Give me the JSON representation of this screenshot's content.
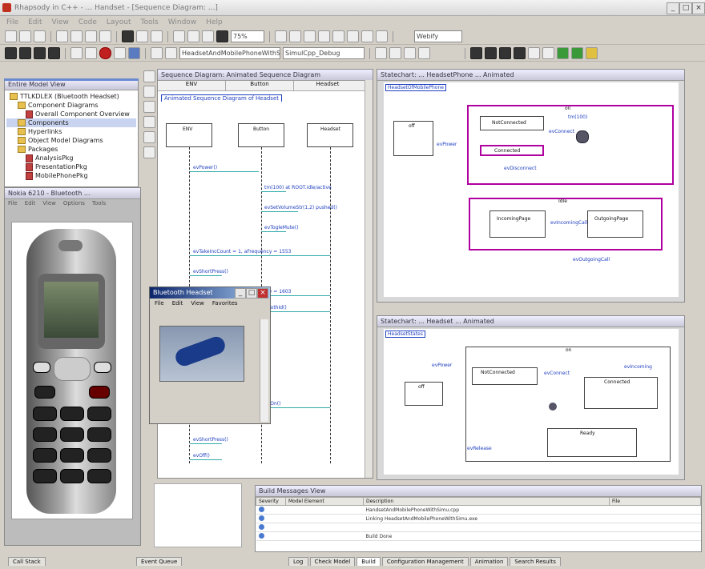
{
  "window": {
    "title": "Rhapsody in C++ - ... Handset - [Sequence Diagram: ...]"
  },
  "menu": [
    "File",
    "Edit",
    "View",
    "Code",
    "Layout",
    "Tools",
    "Window",
    "Help"
  ],
  "toolbar": {
    "zoom_value": "75%",
    "scope_combo": "HeadsetAndMobilePhoneWithSimu",
    "config_combo": "SimulCpp_Debug",
    "webify_label": "Webify"
  },
  "browser": {
    "title": "Entire Model View",
    "items": [
      {
        "label": "TTLKDLEX (Bluetooth Headset)",
        "kind": "folder",
        "indent": 0
      },
      {
        "label": "Component Diagrams",
        "kind": "folder",
        "indent": 1
      },
      {
        "label": "Overall Component Overview",
        "kind": "diagram",
        "indent": 2
      },
      {
        "label": "Components",
        "kind": "folder",
        "indent": 1,
        "selected": true
      },
      {
        "label": "Hyperlinks",
        "kind": "folder",
        "indent": 1
      },
      {
        "label": "Object Model Diagrams",
        "kind": "folder",
        "indent": 1
      },
      {
        "label": "Packages",
        "kind": "folder",
        "indent": 1
      },
      {
        "label": "AnalysisPkg",
        "kind": "diagram",
        "indent": 2
      },
      {
        "label": "PresentationPkg",
        "kind": "diagram",
        "indent": 2
      },
      {
        "label": "MobilePhonePkg",
        "kind": "diagram",
        "indent": 2
      }
    ]
  },
  "phone_window": {
    "title": "Nokia 6210 - Bluetooth ...",
    "menu": [
      "File",
      "Edit",
      "View",
      "Options",
      "Tools",
      "Help"
    ]
  },
  "headset_window": {
    "title": "Bluetooth Headset",
    "menu": [
      "File",
      "Edit",
      "View",
      "Favorites"
    ]
  },
  "sequence": {
    "title": "Sequence Diagram: Animated Sequence Diagram",
    "columns": [
      "ENV",
      "Button",
      "Headset"
    ],
    "label": "Animated Sequence Diagram of Headset",
    "lifelines": [
      "ENV",
      "Button",
      "Headset"
    ],
    "messages": [
      "evPower()",
      "tm(100) at ROOT.idle/active",
      "evSetVolumeStr(1,2) pushed()",
      "evTogleMute()",
      "evTakeIncCount = 1, aFrequency = 1553",
      "evShortPress()",
      "evTakeIncCount = 2, aFrequency = 1603",
      "evInsertCallItemWithId = BluetoothId()",
      "evOn()",
      "evShortPress()",
      "evOff()"
    ]
  },
  "statechart1": {
    "title": "Statechart: ... HeadsetPhone ... Animated",
    "tag": "HeadsetOfMobilePhone",
    "top_label": "on",
    "states": [
      "off",
      "NotConnected",
      "Connected",
      "Idle",
      "IncomingPage",
      "OutgoingPage"
    ],
    "transitions": [
      "evPower",
      "evConnect",
      "evDisconnect",
      "tm(100)",
      "evIncomingCall",
      "evOutgoingCall"
    ]
  },
  "statechart2": {
    "title": "Statechart: ... Headset ... Animated",
    "tag": "HeadsetStates",
    "top_label": "on",
    "states": [
      "off",
      "NotConnected",
      "Connected",
      "Ready"
    ],
    "transitions": [
      "evPower",
      "evConnect",
      "evIncoming",
      "evRelease"
    ]
  },
  "output": {
    "title": "Build Messages View",
    "headers": [
      "Severity",
      "Model Element",
      "Description",
      "File"
    ],
    "rows": [
      {
        "desc": "HandsetAndMobilePhoneWithSimu.cpp"
      },
      {
        "desc": "Linking HeadsetAndMobilePhoneWithSimu.exe"
      },
      {
        "desc": ""
      },
      {
        "desc": "Build Done"
      }
    ],
    "tabs": [
      "Log",
      "Check Model",
      "Build",
      "Configuration Management",
      "Animation",
      "Search Results"
    ]
  },
  "left_bottom_tabs": [
    "Call Stack",
    "Event Queue"
  ]
}
